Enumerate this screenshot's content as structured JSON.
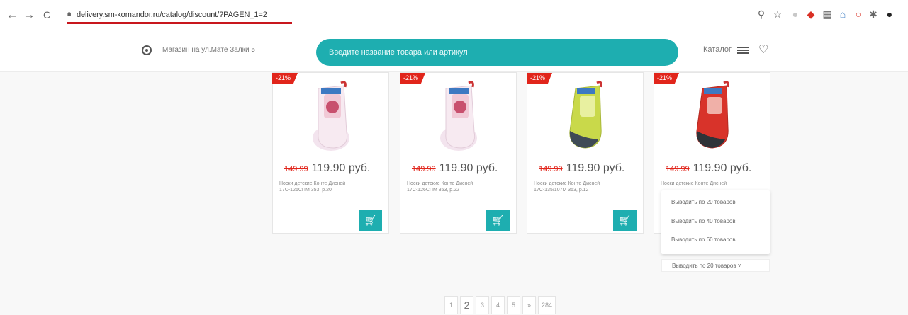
{
  "browser": {
    "back_icon": "←",
    "forward_icon": "→",
    "reload_icon": "C",
    "url": "delivery.sm-komandor.ru/catalog/discount/?PAGEN_1=2"
  },
  "header": {
    "store": "Магазин на ул.Мате Залки 5",
    "search_placeholder": "Введите название товара или артикул",
    "catalog_label": "Каталог"
  },
  "products": [
    {
      "badge": "-21%",
      "old_price": "149.99",
      "price": "119.90 руб.",
      "name": "Носки детские Конте Дисней 17С-126СПМ 353, р.20"
    },
    {
      "badge": "-21%",
      "old_price": "149.99",
      "price": "119.90 руб.",
      "name": "Носки детские Конте Дисней 17С-126СПМ 353, р.22"
    },
    {
      "badge": "-21%",
      "old_price": "149.99",
      "price": "119.90 руб.",
      "name": "Носки детские Конте Дисней 17С-135/107М 353, р.12"
    },
    {
      "badge": "-21%",
      "old_price": "149.99",
      "price": "119.90 руб.",
      "name": "Носки детские Конте Дисней"
    }
  ],
  "per_page": {
    "options": [
      "Выводить по 20 товаров",
      "Выводить по 40 товаров",
      "Выводить по 60 товаров"
    ],
    "selected": "Выводить по 20 товаров ˅"
  },
  "pagination": {
    "pages": [
      "1",
      "2",
      "3",
      "4",
      "5",
      "»",
      "284"
    ],
    "current": "2"
  },
  "colors": {
    "accent": "#1eaeb0",
    "sale": "#e1251b",
    "url_underline": "#c8161d"
  }
}
